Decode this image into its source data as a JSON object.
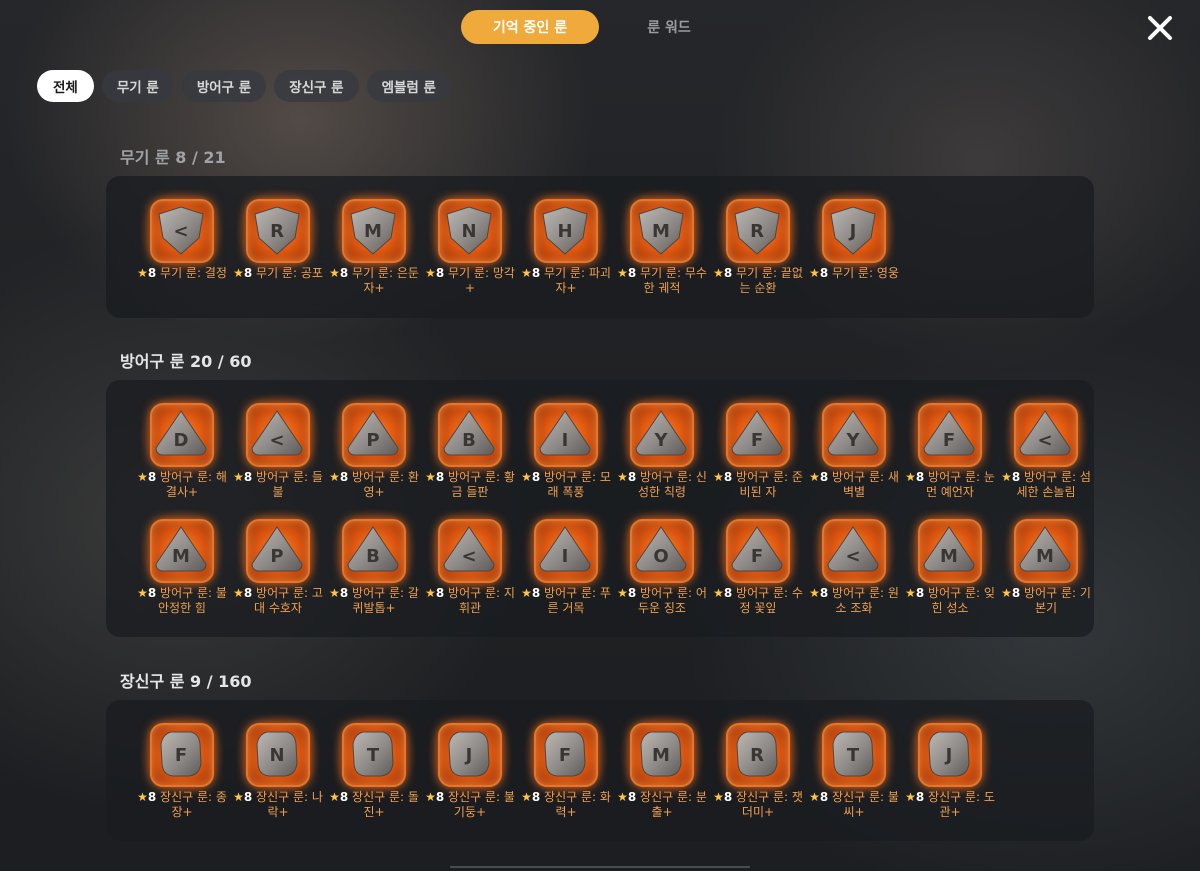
{
  "top_tabs": {
    "active": "기억 중인 룬",
    "inactive": "룬 워드"
  },
  "filters": [
    "전체",
    "무기 룬",
    "방어구 룬",
    "장신구 룬",
    "엠블럼 룬"
  ],
  "colors": {
    "accent": "#f0aa3c",
    "rune_glow": "#e25b12",
    "label": "#f0a050",
    "star": "#ffc34a"
  },
  "sections": [
    {
      "title": "무기 룬  8 / 21",
      "shape": "shield",
      "runes": [
        {
          "level": "8",
          "name": "무기 룬: 결정",
          "glyph": "<"
        },
        {
          "level": "8",
          "name": "무기 룬: 공포",
          "glyph": "R"
        },
        {
          "level": "8",
          "name": "무기 룬: 은둔자+",
          "glyph": "M"
        },
        {
          "level": "8",
          "name": "무기 룬: 망각+",
          "glyph": "N"
        },
        {
          "level": "8",
          "name": "무기 룬: 파괴자+",
          "glyph": "H"
        },
        {
          "level": "8",
          "name": "무기 룬: 무수한 궤적",
          "glyph": "M"
        },
        {
          "level": "8",
          "name": "무기 룬: 끝없는 순환",
          "glyph": "R"
        },
        {
          "level": "8",
          "name": "무기 룬: 영웅",
          "glyph": "J"
        }
      ]
    },
    {
      "title": "방어구 룬  20 / 60",
      "shape": "triangle",
      "runes": [
        {
          "level": "8",
          "name": "방어구 룬: 해결사+",
          "glyph": "D"
        },
        {
          "level": "8",
          "name": "방어구 룬: 들불",
          "glyph": "<"
        },
        {
          "level": "8",
          "name": "방어구 룬: 환영+",
          "glyph": "P"
        },
        {
          "level": "8",
          "name": "방어구 룬: 황금 들판",
          "glyph": "B"
        },
        {
          "level": "8",
          "name": "방어구 룬: 모래 폭풍",
          "glyph": "I"
        },
        {
          "level": "8",
          "name": "방어구 룬: 신성한 칙령",
          "glyph": "Y"
        },
        {
          "level": "8",
          "name": "방어구 룬: 준비된 자",
          "glyph": "F"
        },
        {
          "level": "8",
          "name": "방어구 룬: 새벽별",
          "glyph": "Y"
        },
        {
          "level": "8",
          "name": "방어구 룬: 눈 먼 예언자",
          "glyph": "F"
        },
        {
          "level": "8",
          "name": "방어구 룬: 섬세한 손놀림",
          "glyph": "<"
        },
        {
          "level": "8",
          "name": "방어구 룬: 불안정한 힘",
          "glyph": "M"
        },
        {
          "level": "8",
          "name": "방어구 룬: 고대 수호자",
          "glyph": "P"
        },
        {
          "level": "8",
          "name": "방어구 룬: 갈퀴발톱+",
          "glyph": "B"
        },
        {
          "level": "8",
          "name": "방어구 룬: 지휘관",
          "glyph": "<"
        },
        {
          "level": "8",
          "name": "방어구 룬: 푸른 거목",
          "glyph": "I"
        },
        {
          "level": "8",
          "name": "방어구 룬: 어두운 징조",
          "glyph": "O"
        },
        {
          "level": "8",
          "name": "방어구 룬: 수정 꽃잎",
          "glyph": "F"
        },
        {
          "level": "8",
          "name": "방어구 룬: 원소 조화",
          "glyph": "<"
        },
        {
          "level": "8",
          "name": "방어구 룬: 잊힌 성소",
          "glyph": "M"
        },
        {
          "level": "8",
          "name": "방어구 룬: 기본기",
          "glyph": "M"
        }
      ]
    },
    {
      "title": "장신구 룬  9 / 160",
      "shape": "pebble",
      "runes": [
        {
          "level": "8",
          "name": "장신구 룬: 종장+",
          "glyph": "F"
        },
        {
          "level": "8",
          "name": "장신구 룬: 나락+",
          "glyph": "N"
        },
        {
          "level": "8",
          "name": "장신구 룬: 돌진+",
          "glyph": "T"
        },
        {
          "level": "8",
          "name": "장신구 룬: 불기둥+",
          "glyph": "J"
        },
        {
          "level": "8",
          "name": "장신구 룬: 화력+",
          "glyph": "F"
        },
        {
          "level": "8",
          "name": "장신구 룬: 분출+",
          "glyph": "M"
        },
        {
          "level": "8",
          "name": "장신구 룬: 잿더미+",
          "glyph": "R"
        },
        {
          "level": "8",
          "name": "장신구 룬: 불씨+",
          "glyph": "T"
        },
        {
          "level": "8",
          "name": "장신구 룬: 도관+",
          "glyph": "J"
        }
      ]
    }
  ]
}
